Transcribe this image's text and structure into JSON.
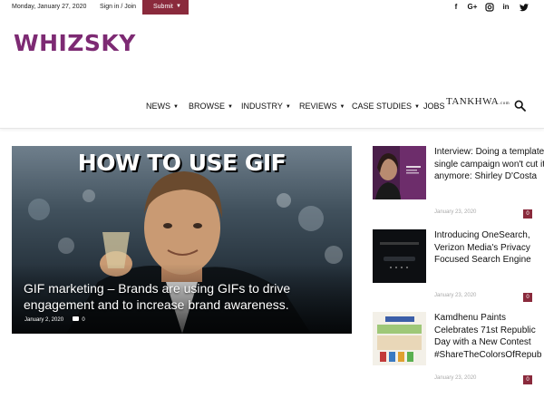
{
  "topbar": {
    "date": "Monday, January 27, 2020",
    "signin": "Sign in / Join",
    "submit": "Submit",
    "social": [
      {
        "icon": "facebook-icon",
        "glyph": "f"
      },
      {
        "icon": "google-plus-icon",
        "glyph": "G+"
      },
      {
        "icon": "instagram-icon",
        "glyph": "◎"
      },
      {
        "icon": "linkedin-icon",
        "glyph": "in"
      },
      {
        "icon": "twitter-icon",
        "glyph": "🐦"
      }
    ]
  },
  "logo": {
    "text": "WHIZSKY",
    "color": "#7d2a73"
  },
  "nav": {
    "items": [
      "NEWS",
      "BROWSE",
      "INDUSTRY",
      "REVIEWS",
      "CASE STUDIES",
      "JOBS"
    ],
    "partner": "TANKHWA",
    "partner_suffix": ".com"
  },
  "hero": {
    "image_text": "HOW TO USE GIF",
    "title": "GIF marketing – Brands are using GIFs to drive engagement and to increase brand awareness.",
    "date": "January 2, 2020",
    "comments": "0"
  },
  "posts": [
    {
      "title": "Interview: Doing a template single campaign won't cut it anymore: Shirley D'Costa",
      "date": "January 23, 2020",
      "comments": "0"
    },
    {
      "title": "Introducing OneSearch, Verizon Media's Privacy Focused Search Engine",
      "date": "January 23, 2020",
      "comments": "0"
    },
    {
      "title": "Kamdhenu Paints Celebrates 71st Republic Day with a New Contest #ShareTheColorsOfRepub",
      "date": "January 23, 2020",
      "comments": "0"
    }
  ],
  "colors": {
    "accent": "#8a2a3c",
    "brand": "#7d2a73"
  }
}
